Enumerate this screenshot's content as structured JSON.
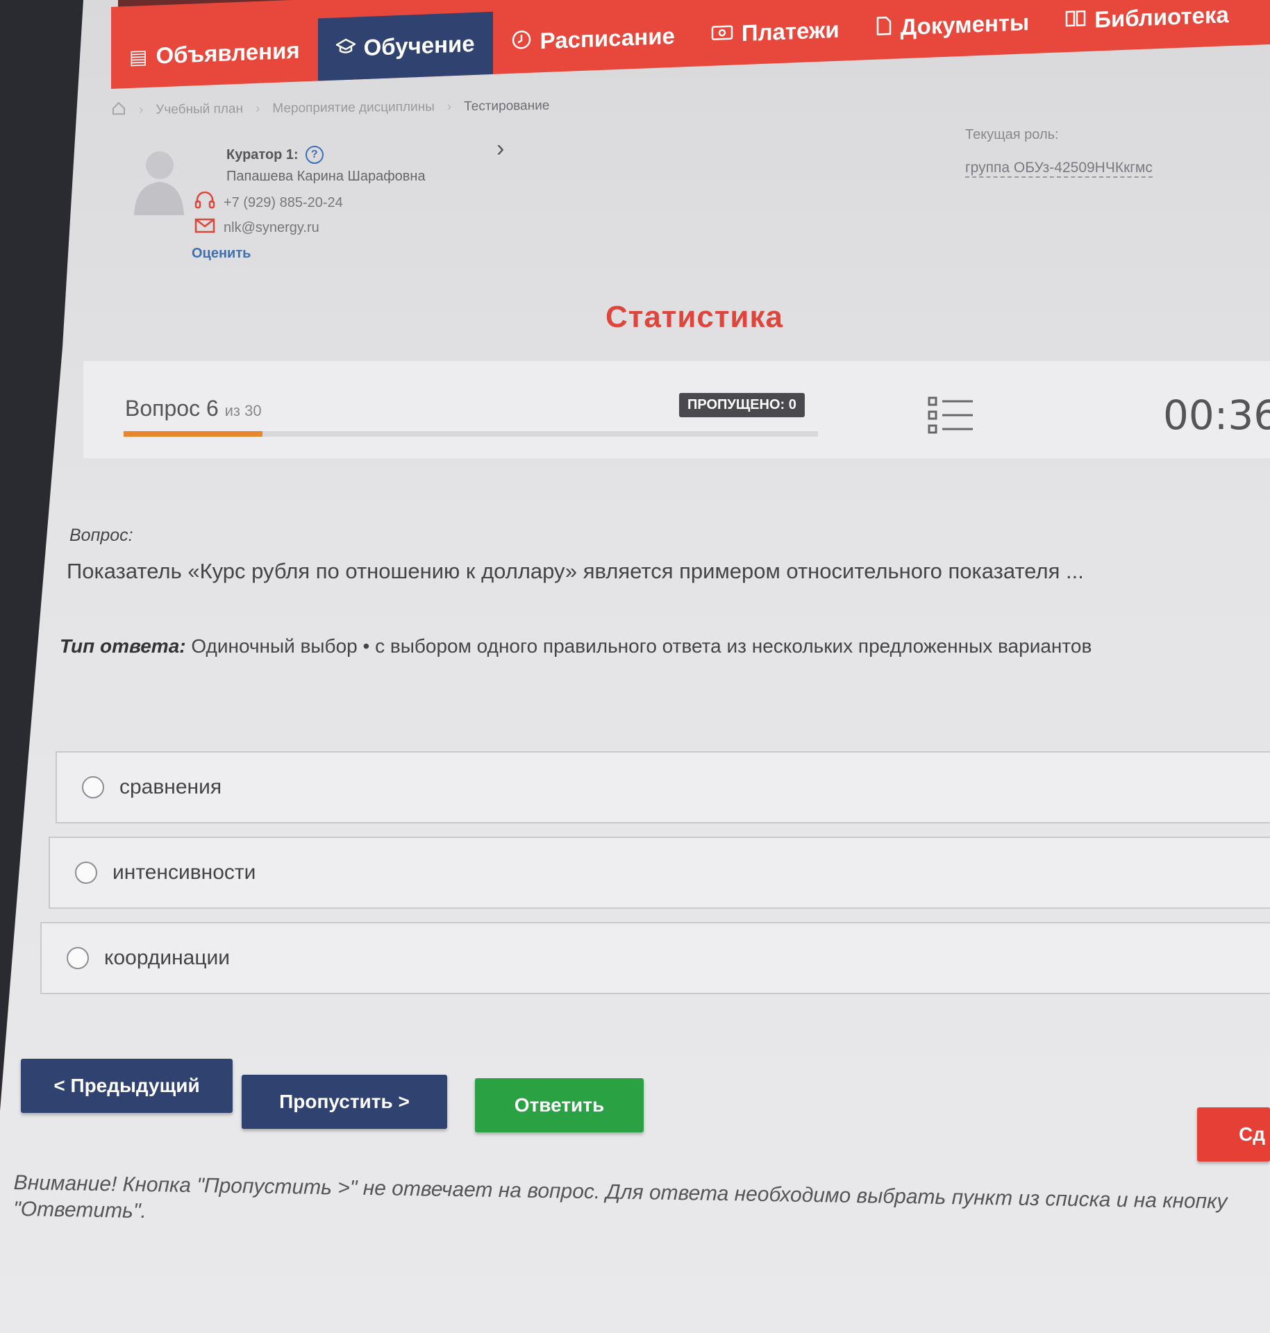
{
  "nav": {
    "items": [
      {
        "label": "Объявления",
        "icon": "newspaper-icon",
        "glyph": "▤",
        "active": false
      },
      {
        "label": "Обучение",
        "icon": "graduation-cap-icon",
        "glyph": "🎓",
        "active": true
      },
      {
        "label": "Расписание",
        "icon": "clock-icon",
        "glyph": "◷",
        "active": false
      },
      {
        "label": "Платежи",
        "icon": "money-icon",
        "glyph": "▭",
        "active": false
      },
      {
        "label": "Документы",
        "icon": "document-icon",
        "glyph": "▯",
        "active": false
      },
      {
        "label": "Библиотека",
        "icon": "book-icon",
        "glyph": "▥",
        "active": false
      }
    ]
  },
  "breadcrumb": {
    "items": [
      "Учебный план",
      "Мероприятие дисциплины",
      "Тестирование"
    ]
  },
  "curator": {
    "title": "Куратор 1:",
    "name": "Папашева Карина Шарафовна",
    "phone": "+7 (929) 885-20-24",
    "email": "nlk@synergy.ru",
    "rate_label": "Оценить"
  },
  "role": {
    "label": "Текущая роль:",
    "value": "группа ОБУз-42509НЧКкгмс"
  },
  "page_title": "Статистика",
  "status": {
    "question_label": "Вопрос 6",
    "question_total": "из 30",
    "progress_fraction": 0.2,
    "skipped": "ПРОПУЩЕНО: 0",
    "timer": "00:36"
  },
  "question": {
    "label": "Вопрос:",
    "text": "Показатель «Курс рубля по отношению к доллару» является примером относительного показателя ...",
    "type_label": "Тип ответа:",
    "type_value": "Одиночный выбор • с выбором одного правильного ответа из нескольких предложенных вариантов"
  },
  "options": [
    "сравнения",
    "интенсивности",
    "координации"
  ],
  "buttons": {
    "prev": "< Предыдущий",
    "skip": "Пропустить >",
    "answer": "Ответить",
    "finish": "Сд"
  },
  "notice": "Внимание! Кнопка \"Пропустить >\" не отвечает на вопрос. Для ответа необходимо выбрать пункт из списка и на кнопку \"Ответить\".",
  "colors": {
    "nav_red": "#e8473c",
    "nav_active": "#2f4270",
    "title_red": "#e0453c",
    "answer_green": "#2aa244",
    "progress_orange": "#e8862e"
  }
}
